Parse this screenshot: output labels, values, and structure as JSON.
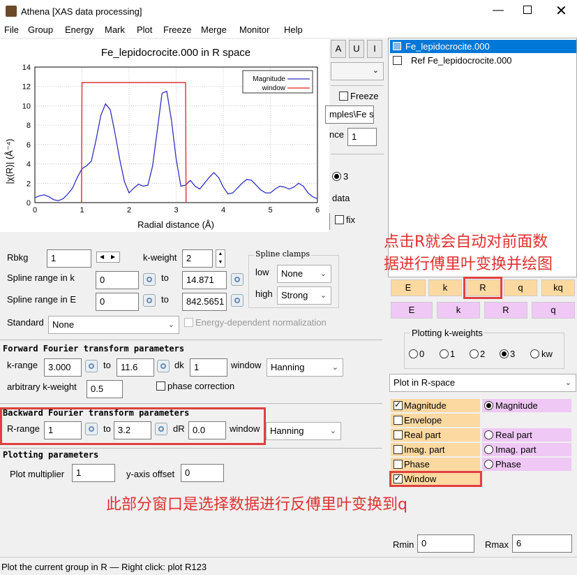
{
  "window": {
    "title": "Athena [XAS data processing]"
  },
  "menu": [
    "File",
    "Group",
    "Energy",
    "Mark",
    "Plot",
    "Freeze",
    "Merge",
    "Monitor",
    "Help"
  ],
  "plot": {
    "title": "Fe_lepidocrocite.000 in R space",
    "legend": [
      "Magnitude",
      "window"
    ]
  },
  "chart_data": {
    "type": "line",
    "title": "Fe_lepidocrocite.000 in R space",
    "xlabel": "Radial distance   (Å)",
    "ylabel": "|χ(R)|   (Å⁻⁴)",
    "xlim": [
      0,
      6
    ],
    "ylim": [
      0,
      14
    ],
    "xticks": [
      "0",
      "1",
      "2",
      "3",
      "4",
      "5",
      "6"
    ],
    "yticks": [
      "0",
      "2",
      "4",
      "6",
      "8",
      "10",
      "12",
      "14"
    ],
    "legend_position": "top-right",
    "series": [
      {
        "name": "Magnitude",
        "color": "#3030c0",
        "x": [
          0,
          0.1,
          0.2,
          0.3,
          0.4,
          0.5,
          0.6,
          0.7,
          0.8,
          0.9,
          1.0,
          1.1,
          1.2,
          1.3,
          1.4,
          1.5,
          1.6,
          1.7,
          1.8,
          1.9,
          2.0,
          2.1,
          2.2,
          2.3,
          2.4,
          2.5,
          2.6,
          2.7,
          2.8,
          2.9,
          3.0,
          3.1,
          3.2,
          3.3,
          3.4,
          3.5,
          3.6,
          3.7,
          3.8,
          3.9,
          4.0,
          4.1,
          4.2,
          4.3,
          4.4,
          4.5,
          4.6,
          4.7,
          4.8,
          4.9,
          5.0,
          5.1,
          5.2,
          5.3,
          5.4,
          5.5,
          5.6,
          5.7,
          5.8,
          5.9,
          6.0
        ],
        "y": [
          0.5,
          0.7,
          0.8,
          0.6,
          0.3,
          0.2,
          0.4,
          0.9,
          1.5,
          2.6,
          3.5,
          3.8,
          4.3,
          6.5,
          9.0,
          10.2,
          9.6,
          7.2,
          4.5,
          2.2,
          1.0,
          1.5,
          1.9,
          1.7,
          1.8,
          3.8,
          7.5,
          11.3,
          11.5,
          8.5,
          4.5,
          1.7,
          1.8,
          2.3,
          1.7,
          1.4,
          2.0,
          2.6,
          3.1,
          2.6,
          1.6,
          0.9,
          1.0,
          1.5,
          2.0,
          2.4,
          2.3,
          1.8,
          1.3,
          1.0,
          1.0,
          1.4,
          1.7,
          1.6,
          1.4,
          1.6,
          2.0,
          1.7,
          1.0,
          0.6,
          0.4
        ]
      },
      {
        "name": "window",
        "color": "#e02020",
        "x": [
          0.99,
          1.0,
          3.2,
          3.21
        ],
        "y": [
          0,
          12.4,
          12.4,
          0
        ]
      }
    ]
  },
  "topright": {
    "btn_a": "A",
    "btn_u": "U",
    "btn_i": "I",
    "freeze": "Freeze",
    "path": "mples\\Fe s",
    "nce_label": "nce",
    "nce_value": "1",
    "radio3": "3",
    "data_label": "data",
    "fix_label": "fix"
  },
  "groups": [
    {
      "label": "Fe_lepidocrocite.000",
      "checked": false,
      "selected": true
    },
    {
      "label": "Ref Fe_lepidocrocite.000",
      "checked": false,
      "selected": false
    }
  ],
  "bkg": {
    "rbkg_label": "Rbkg",
    "rbkg_value": "1",
    "kweight_label": "k-weight",
    "kweight_value": "2",
    "spline_k_label": "Spline range in k",
    "spline_k_from": "0",
    "to1": "to",
    "spline_k_to": "14.871",
    "spline_e_label": "Spline range in E",
    "spline_e_from": "0",
    "to2": "to",
    "spline_e_to": "842.5651",
    "standard_label": "Standard",
    "standard_value": "None",
    "energy_norm": "Energy-dependent normalization",
    "clamps_title": "Spline clamps",
    "clamp_low_label": "low",
    "clamp_low_value": "None",
    "clamp_high_label": "high",
    "clamp_high_value": "Strong"
  },
  "fft": {
    "title": "Forward Fourier transform parameters",
    "krange_label": "k-range",
    "kmin": "3.000",
    "to": "to",
    "kmax": "11.6",
    "dk_label": "dk",
    "dk_value": "1",
    "window_label": "window",
    "window_value": "Hanning",
    "arb_label": "arbitrary k-weight",
    "arb_value": "0.5",
    "phase_label": "phase correction"
  },
  "bft": {
    "title": "Backward Fourier transform parameters",
    "rrange_label": "R-range",
    "rmin": "1",
    "to": "to",
    "rmax": "3.2",
    "dr_label": "dR",
    "dr_value": "0.0",
    "window_label": "window",
    "window_value": "Hanning"
  },
  "plotparams": {
    "title": "Plotting parameters",
    "mult_label": "Plot multiplier",
    "mult_value": "1",
    "offset_label": "y-axis offset",
    "offset_value": "0"
  },
  "plot_buttons": {
    "row1": [
      "E",
      "k",
      "R",
      "q",
      "kq"
    ],
    "row2": [
      "E",
      "k",
      "R",
      "q"
    ]
  },
  "kweights": {
    "title": "Plotting k-weights",
    "options": [
      "0",
      "1",
      "2",
      "3",
      "kw"
    ],
    "selected": "3"
  },
  "plot_space": "Plot in R-space",
  "r_options_left": [
    {
      "label": "Magnitude",
      "checked": true
    },
    {
      "label": "Envelope",
      "checked": false
    },
    {
      "label": "Real part",
      "checked": false
    },
    {
      "label": "Imag. part",
      "checked": false
    },
    {
      "label": "Phase",
      "checked": false
    },
    {
      "label": "Window",
      "checked": true
    }
  ],
  "r_options_right": [
    {
      "label": "Magnitude",
      "selected": true
    },
    {
      "label": "Real part",
      "selected": false
    },
    {
      "label": "Imag. part",
      "selected": false
    },
    {
      "label": "Phase",
      "selected": false
    }
  ],
  "rmin_label": "Rmin",
  "rmin_value": "0",
  "rmax_label": "Rmax",
  "rmax_value": "6",
  "status": "Plot the current group in R  —  Right click: plot R123",
  "annotations": {
    "note_r_line1": "点击R就会自动对前面数",
    "note_r_line2": "据进行傅里叶变换并绘图",
    "note_window": "此部分窗口是选择数据进行反傅里叶变换到q"
  }
}
